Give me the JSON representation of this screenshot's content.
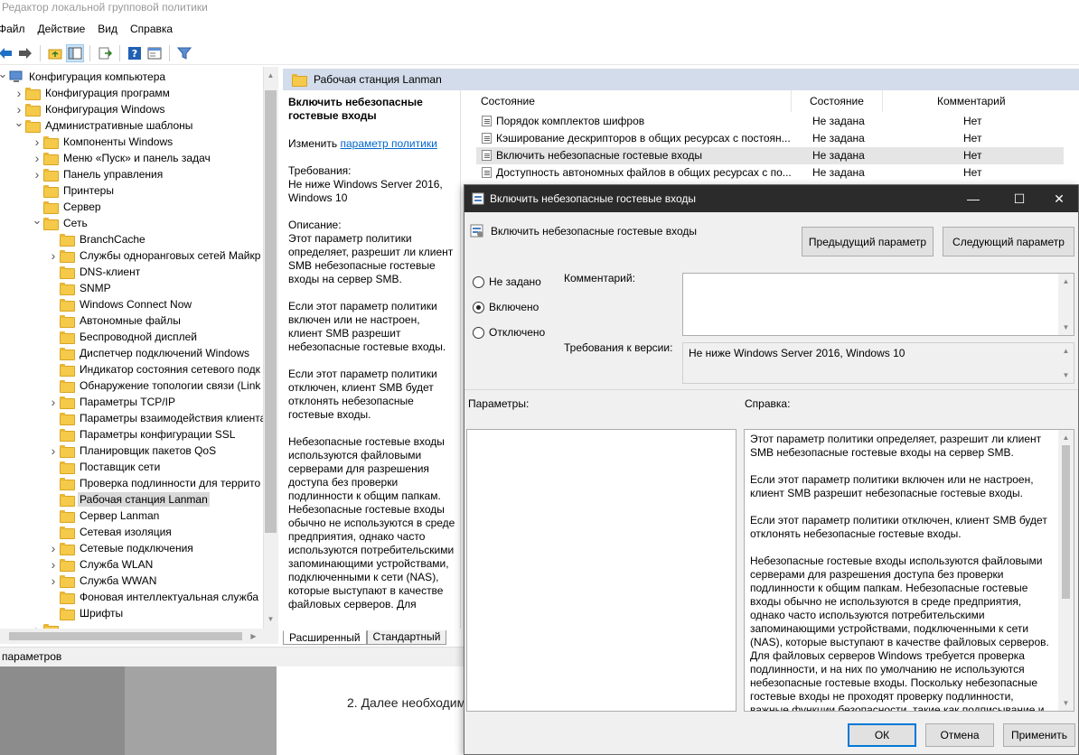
{
  "window": {
    "title": "Редактор локальной групповой политики"
  },
  "menu": [
    "Файл",
    "Действие",
    "Вид",
    "Справка"
  ],
  "tree": {
    "items": [
      {
        "label": "Конфигурация компьютера",
        "level": 0,
        "chev": "v",
        "icon": "computer"
      },
      {
        "label": "Конфигурация программ",
        "level": 1,
        "chev": ">"
      },
      {
        "label": "Конфигурация Windows",
        "level": 1,
        "chev": ">"
      },
      {
        "label": "Административные шаблоны",
        "level": 1,
        "chev": "v"
      },
      {
        "label": "Компоненты Windows",
        "level": 2,
        "chev": ">"
      },
      {
        "label": "Меню «Пуск» и панель задач",
        "level": 2,
        "chev": ">"
      },
      {
        "label": "Панель управления",
        "level": 2,
        "chev": ">"
      },
      {
        "label": "Принтеры",
        "level": 2,
        "chev": ""
      },
      {
        "label": "Сервер",
        "level": 2,
        "chev": ""
      },
      {
        "label": "Сеть",
        "level": 2,
        "chev": "v"
      },
      {
        "label": "BranchCache",
        "level": 3,
        "chev": ""
      },
      {
        "label": "Службы одноранговых сетей Майкр",
        "level": 3,
        "chev": ">"
      },
      {
        "label": "DNS-клиент",
        "level": 3,
        "chev": ""
      },
      {
        "label": "SNMP",
        "level": 3,
        "chev": ""
      },
      {
        "label": "Windows Connect Now",
        "level": 3,
        "chev": ""
      },
      {
        "label": "Автономные файлы",
        "level": 3,
        "chev": ""
      },
      {
        "label": "Беспроводной дисплей",
        "level": 3,
        "chev": ""
      },
      {
        "label": "Диспетчер подключений Windows",
        "level": 3,
        "chev": ""
      },
      {
        "label": "Индикатор состояния сетевого подк",
        "level": 3,
        "chev": ""
      },
      {
        "label": "Обнаружение топологии связи (Link",
        "level": 3,
        "chev": ""
      },
      {
        "label": "Параметры TCP/IP",
        "level": 3,
        "chev": ">"
      },
      {
        "label": "Параметры взаимодействия клиента",
        "level": 3,
        "chev": ""
      },
      {
        "label": "Параметры конфигурации SSL",
        "level": 3,
        "chev": ""
      },
      {
        "label": "Планировщик пакетов QoS",
        "level": 3,
        "chev": ">"
      },
      {
        "label": "Поставщик сети",
        "level": 3,
        "chev": ""
      },
      {
        "label": "Проверка подлинности для террито",
        "level": 3,
        "chev": ""
      },
      {
        "label": "Рабочая станция Lanman",
        "level": 3,
        "chev": "",
        "selected": true
      },
      {
        "label": "Сервер Lanman",
        "level": 3,
        "chev": ""
      },
      {
        "label": "Сетевая изоляция",
        "level": 3,
        "chev": ""
      },
      {
        "label": "Сетевые подключения",
        "level": 3,
        "chev": ">"
      },
      {
        "label": "Служба WLAN",
        "level": 3,
        "chev": ">"
      },
      {
        "label": "Служба WWAN",
        "level": 3,
        "chev": ">"
      },
      {
        "label": "Фоновая интеллектуальная служба",
        "level": 3,
        "chev": ""
      },
      {
        "label": "Шрифты",
        "level": 3,
        "chev": ""
      }
    ]
  },
  "right_pane": {
    "header": "Рабочая станция Lanman",
    "desc_title": "Включить небезопасные гостевые входы",
    "desc_edit_prefix": "Изменить ",
    "desc_edit_link": "параметр политики",
    "desc_req_label": "Требования:",
    "desc_req_value": "Не ниже Windows Server 2016, Windows 10",
    "desc_label": "Описание:",
    "desc_p1": "Этот параметр политики определяет, разрешит ли клиент SMB небезопасные гостевые входы на сервер SMB.",
    "desc_p2": "Если этот параметр политики включен или не настроен, клиент SMB разрешит небезопасные гостевые входы.",
    "desc_p3": "Если этот параметр политики отключен, клиент SMB будет отклонять небезопасные гостевые входы.",
    "desc_p4": "Небезопасные гостевые входы используются файловыми серверами для разрешения доступа без проверки подлинности к общим папкам. Небезопасные гостевые входы обычно не используются в среде предприятия, однако часто используются потребительскими запоминающими устройствами, подключенными к сети (NAS), которые выступают в качестве файловых серверов. Для",
    "tabs": [
      "Расширенный",
      "Стандартный"
    ],
    "columns": [
      "Состояние",
      "Состояние",
      "Комментарий"
    ],
    "rows": [
      {
        "name": "Порядок комплектов шифров",
        "state": "Не задана",
        "comment": "Нет"
      },
      {
        "name": "Кэширование дескрипторов в общих ресурсах с постоян...",
        "state": "Не задана",
        "comment": "Нет"
      },
      {
        "name": "Включить небезопасные гостевые входы",
        "state": "Не задана",
        "comment": "Нет",
        "selected": true
      },
      {
        "name": "Доступность автономных файлов в общих ресурсах с по...",
        "state": "Не задана",
        "comment": "Нет"
      }
    ]
  },
  "status_bar": {
    "text": "параметров"
  },
  "background_article": {
    "text": "2. Далее необходим"
  },
  "dialog": {
    "title": "Включить небезопасные гостевые входы",
    "setting_name": "Включить небезопасные гостевые входы",
    "prev_button": "Предыдущий параметр",
    "next_button": "Следующий параметр",
    "radio_not_set": "Не задано",
    "radio_enabled": "Включено",
    "radio_disabled": "Отключено",
    "comment_label": "Комментарий:",
    "version_label": "Требования к версии:",
    "version_value": "Не ниже Windows Server 2016, Windows 10",
    "params_label": "Параметры:",
    "help_label": "Справка:",
    "help_p1": "Этот параметр политики определяет, разрешит ли клиент SMB небезопасные гостевые входы на сервер SMB.",
    "help_p2": "Если этот параметр политики включен или не настроен, клиент SMB разрешит небезопасные гостевые входы.",
    "help_p3": "Если этот параметр политики отключен, клиент SMB будет отклонять небезопасные гостевые входы.",
    "help_p4": "Небезопасные гостевые входы используются файловыми серверами для разрешения доступа без проверки подлинности к общим папкам. Небезопасные гостевые входы обычно не используются в среде предприятия, однако часто используются потребительскими запоминающими устройствами, подключенными к сети (NAS), которые выступают в качестве файловых серверов. Для файловых серверов Windows требуется проверка подлинности, и на них по умолчанию не используются небезопасные гостевые входы. Поскольку небезопасные гостевые входы не проходят проверку подлинности, важные функции безопасности, такие как подписывание и шифрование SMB-пакетов",
    "ok_button": "ОК",
    "cancel_button": "Отмена",
    "apply_button": "Применить",
    "selected_radio": "enabled"
  }
}
